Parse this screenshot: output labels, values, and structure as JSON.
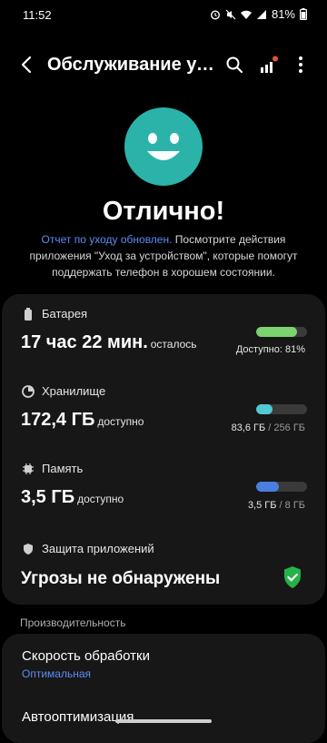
{
  "status_bar": {
    "time": "11:52",
    "battery_percent": "81%"
  },
  "header": {
    "title": "Обслуживание ус…"
  },
  "status": {
    "title": "Отлично!",
    "link_text": "Отчет по уходу обновлен.",
    "description": " Посмотрите действия приложения \"Уход за устройством\", которые помогут поддержать телефон в хорошем состоянии."
  },
  "battery": {
    "label": "Батарея",
    "value": "17 час 22 мин.",
    "value_suffix": "осталось",
    "meter_text": "Доступно: 81%",
    "level": 0.81,
    "color": "#7ad36f"
  },
  "storage": {
    "label": "Хранилище",
    "value": "172,4 ГБ",
    "value_suffix": "доступно",
    "used": "83,6 ГБ",
    "sep": " / ",
    "total": "256 ГБ",
    "level": 0.33,
    "color": "#52c8d3"
  },
  "memory": {
    "label": "Память",
    "value": "3,5 ГБ",
    "value_suffix": "доступно",
    "used": "3,5 ГБ",
    "sep": " / ",
    "total": "8 ГБ",
    "level": 0.44,
    "color": "#4a7fe0"
  },
  "protection": {
    "label": "Защита приложений",
    "value": "Угрозы не обнаружены",
    "shield_color": "#26b24a"
  },
  "performance": {
    "section_title": "Производительность",
    "speed_title": "Скорость обработки",
    "speed_value": "Оптимальная",
    "auto_title": "Автооптимизация"
  },
  "colors": {
    "accent": "#5d8bf4",
    "smiley": "#2bb3aa",
    "card": "#171717",
    "notification_dot": "#e2552e"
  }
}
